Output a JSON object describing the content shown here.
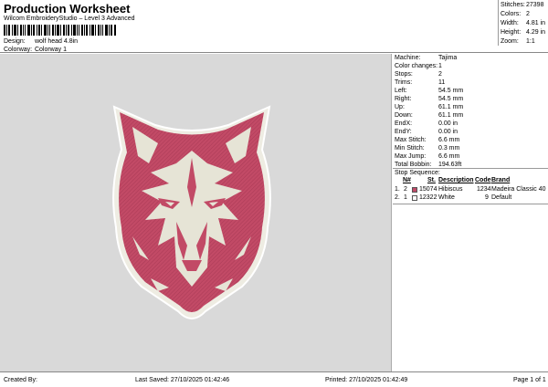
{
  "header": {
    "title": "Production Worksheet",
    "subtitle": "Wilcom EmbroideryStudio – Level 3 Advanced",
    "design_label": "Design:",
    "design_value": "wolf head 4.8in",
    "colorway_label": "Colorway:",
    "colorway_value": "Colorway 1"
  },
  "summary": {
    "stitches_label": "Stitches:",
    "stitches_value": "27398",
    "colors_label": "Colors:",
    "colors_value": "2",
    "width_label": "Width:",
    "width_value": "4.81 in",
    "height_label": "Height:",
    "height_value": "4.29 in",
    "zoom_label": "Zoom:",
    "zoom_value": "1:1"
  },
  "details": [
    {
      "label": "Machine:",
      "value": "Tajima"
    },
    {
      "label": "Color changes:",
      "value": "1"
    },
    {
      "label": "Stops:",
      "value": "2"
    },
    {
      "label": "Trims:",
      "value": "11"
    },
    {
      "label": "Left:",
      "value": "54.5 mm"
    },
    {
      "label": "Right:",
      "value": "54.5 mm"
    },
    {
      "label": "Up:",
      "value": "61.1 mm"
    },
    {
      "label": "Down:",
      "value": "61.1 mm"
    },
    {
      "label": "EndX:",
      "value": "0.00 in"
    },
    {
      "label": "EndY:",
      "value": "0.00 in"
    },
    {
      "label": "Max Stitch:",
      "value": "6.6 mm"
    },
    {
      "label": "Min Stitch:",
      "value": "0.3 mm"
    },
    {
      "label": "Max Jump:",
      "value": "6.6 mm"
    },
    {
      "label": "Total Bobbin:",
      "value": "194.63ft"
    }
  ],
  "stop_sequence": {
    "heading": "Stop Sequence:",
    "columns": [
      "N#",
      "St.",
      "Description",
      "Code",
      "Brand"
    ],
    "rows": [
      {
        "index": "1.",
        "n": "2",
        "st": "15074",
        "description": "Hibiscus",
        "code": "1234",
        "brand": "Madeira Classic 40",
        "color": "#c04a68"
      },
      {
        "index": "2.",
        "n": "1",
        "st": "12322",
        "description": "White",
        "code": "9",
        "brand": "Default",
        "color": "#ffffff"
      }
    ]
  },
  "design_colors": {
    "fill": "#c24a66",
    "light": "#e6e4d6",
    "outline": "#f0eee4"
  },
  "footer": {
    "created_by": "Created By:",
    "last_saved": "Last Saved: 27/10/2025 01:42:46",
    "printed": "Printed: 27/10/2025 01:42:49",
    "page": "Page 1 of 1"
  }
}
